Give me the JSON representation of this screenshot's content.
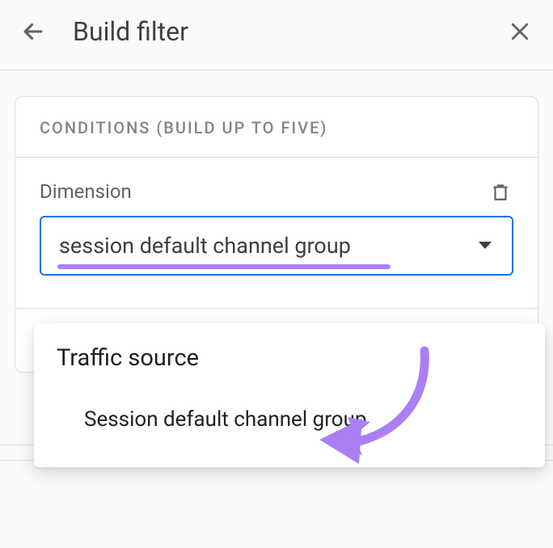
{
  "header": {
    "title": "Build filter"
  },
  "card": {
    "header": "CONDITIONS (BUILD UP TO FIVE)",
    "dimension_label": "Dimension",
    "select_value": "session default channel group"
  },
  "dropdown": {
    "category": "Traffic source",
    "item": "Session default channel group"
  }
}
